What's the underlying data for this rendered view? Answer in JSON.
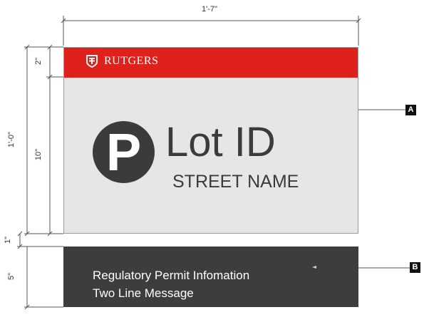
{
  "dimensions": {
    "overall_width": "1'-7\"",
    "overall_height": "1'-0\"",
    "header_height": "2\"",
    "body_height": "10\"",
    "gap_height": "1\"",
    "panel_b_height": "5\""
  },
  "sign_a": {
    "brand": "RUTGERS",
    "parking_symbol": "P",
    "lot_id": "Lot ID",
    "street_name": "STREET NAME",
    "callout": "A"
  },
  "sign_b": {
    "line1": "Regulatory Permit Infomation",
    "line2": "Two Line Message",
    "callout": "B"
  },
  "colors": {
    "header_red": "#df211b",
    "sign_a_body": "#e6e6e6",
    "dark_gray": "#3b3b3b",
    "sign_b_body": "#3d3d3d"
  },
  "icons": [
    "rutgers-shield-icon"
  ]
}
